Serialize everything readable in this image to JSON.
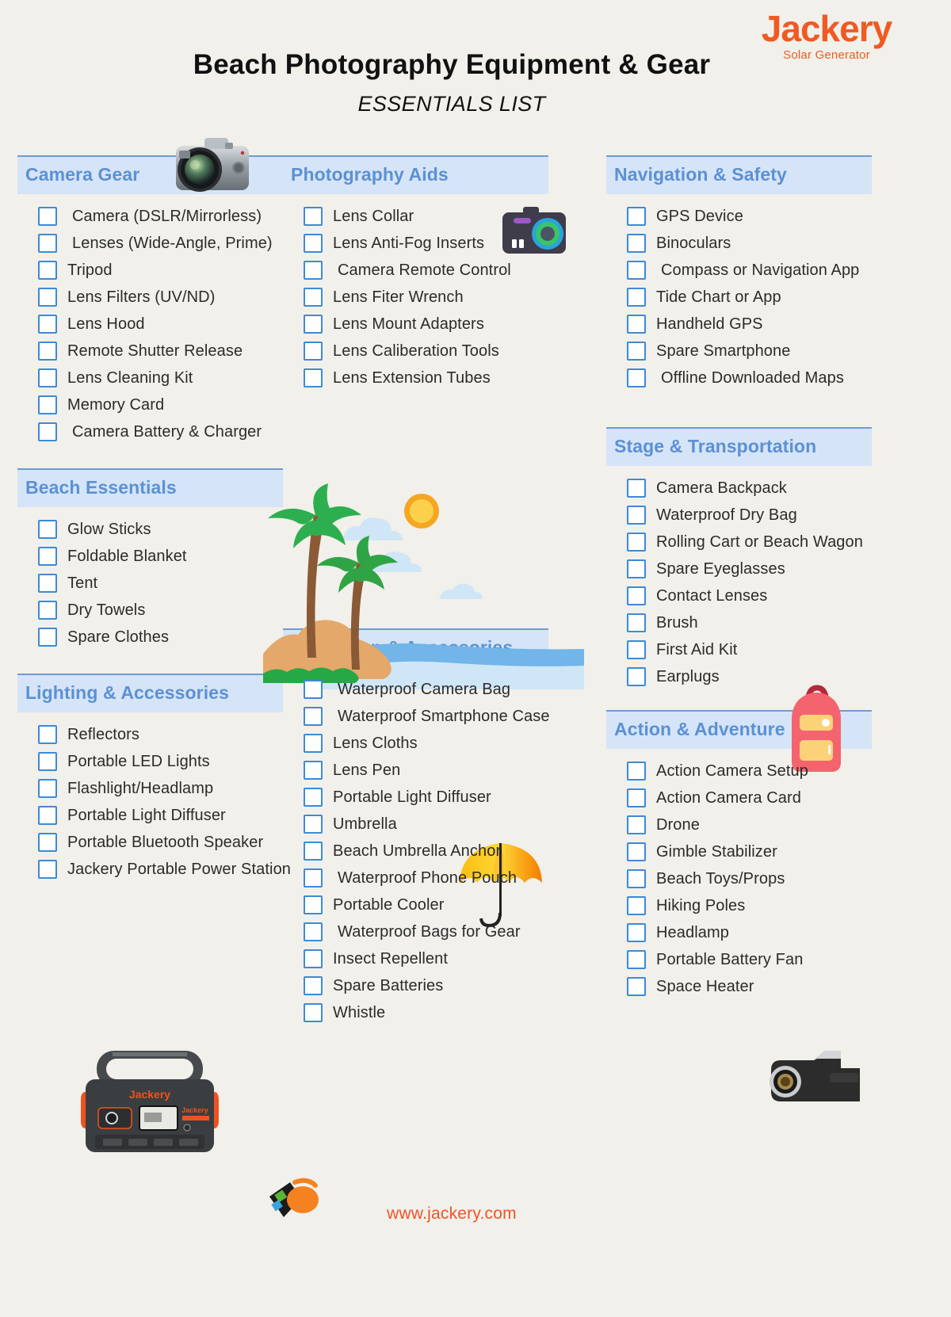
{
  "brand": {
    "name": "Jackery",
    "tagline": "Solar Generator"
  },
  "header": {
    "title": "Beach  Photography Equipment & Gear",
    "subtitle": "ESSENTIALS LIST"
  },
  "footer": {
    "website": "www.jackery.com"
  },
  "colors": {
    "page_background": "#f2f0ea",
    "section_header_bg": "#d5e4f7",
    "section_header_border": "#6f9bd1",
    "section_header_text": "#5b91d4",
    "checkbox_border": "#3d8ad6",
    "brand_orange": "#f05a22",
    "item_text": "#2b2b2b"
  },
  "columns": [
    {
      "sections": [
        {
          "title": "Camera Gear",
          "items": [
            {
              "label": "Camera (DSLR/Mirrorless)",
              "indent": true
            },
            {
              "label": "Lenses (Wide-Angle, Prime)",
              "indent": true
            },
            {
              "label": "Tripod",
              "indent": false
            },
            {
              "label": "Lens Filters (UV/ND)",
              "indent": false
            },
            {
              "label": "Lens Hood",
              "indent": false
            },
            {
              "label": "Remote Shutter Release",
              "indent": false
            },
            {
              "label": "Lens Cleaning Kit",
              "indent": false
            },
            {
              "label": "Memory Card",
              "indent": false
            },
            {
              "label": "Camera Battery & Charger",
              "indent": true
            }
          ]
        },
        {
          "title": "Beach Essentials",
          "items": [
            {
              "label": "Glow Sticks",
              "indent": false
            },
            {
              "label": "Foldable Blanket",
              "indent": false
            },
            {
              "label": "Tent",
              "indent": false
            },
            {
              "label": "Dry Towels",
              "indent": false
            },
            {
              "label": "Spare Clothes",
              "indent": false
            }
          ]
        },
        {
          "title": "Lighting & Accessories",
          "items": [
            {
              "label": "Reflectors",
              "indent": false
            },
            {
              "label": "Portable LED Lights",
              "indent": false
            },
            {
              "label": "Flashlight/Headlamp",
              "indent": false
            },
            {
              "label": "Portable Light Diffuser",
              "indent": false
            },
            {
              "label": "Portable Bluetooth Speaker",
              "indent": false
            },
            {
              "label": "Jackery Portable Power Station",
              "indent": false
            }
          ]
        }
      ]
    },
    {
      "sections": [
        {
          "title": "Photography Aids",
          "items": [
            {
              "label": "Lens Collar",
              "indent": false
            },
            {
              "label": "Lens Anti-Fog Inserts",
              "indent": false
            },
            {
              "label": "Camera Remote Control",
              "indent": true
            },
            {
              "label": "Lens Fiter Wrench",
              "indent": false
            },
            {
              "label": "Lens Mount Adapters",
              "indent": false
            },
            {
              "label": "Lens Caliberation Tools",
              "indent": false
            },
            {
              "label": "Lens Extension Tubes",
              "indent": false
            }
          ]
        },
        {
          "title": "Protection & Accessories",
          "items": [
            {
              "label": "Waterproof Camera Bag",
              "indent": true
            },
            {
              "label": "Waterproof Smartphone Case",
              "indent": true
            },
            {
              "label": "Lens Cloths",
              "indent": false
            },
            {
              "label": "Lens Pen",
              "indent": false
            },
            {
              "label": "Portable Light Diffuser",
              "indent": false
            },
            {
              "label": "Umbrella",
              "indent": false
            },
            {
              "label": "Beach Umbrella Anchor",
              "indent": false
            },
            {
              "label": "Waterproof Phone Pouch",
              "indent": true
            },
            {
              "label": "Portable Cooler",
              "indent": false
            },
            {
              "label": "Waterproof Bags for Gear",
              "indent": true
            },
            {
              "label": "Insect Repellent",
              "indent": false
            },
            {
              "label": "Spare Batteries",
              "indent": false
            },
            {
              "label": "Whistle",
              "indent": false
            }
          ]
        }
      ]
    },
    {
      "sections": [
        {
          "title": "Navigation & Safety",
          "items": [
            {
              "label": "GPS Device",
              "indent": false
            },
            {
              "label": "Binoculars",
              "indent": false
            },
            {
              "label": "Compass or Navigation App",
              "indent": true
            },
            {
              "label": "Tide Chart or App",
              "indent": false
            },
            {
              "label": "Handheld GPS",
              "indent": false
            },
            {
              "label": "Spare Smartphone",
              "indent": false
            },
            {
              "label": "Offline Downloaded Maps",
              "indent": true
            }
          ]
        },
        {
          "title": "Stage & Transportation",
          "items": [
            {
              "label": "Camera Backpack",
              "indent": false
            },
            {
              "label": "Waterproof Dry Bag",
              "indent": false
            },
            {
              "label": "Rolling Cart or Beach Wagon",
              "indent": false
            },
            {
              "label": "Spare Eyeglasses",
              "indent": false
            },
            {
              "label": "Contact Lenses",
              "indent": false
            },
            {
              "label": "Brush",
              "indent": false
            },
            {
              "label": "First Aid Kit",
              "indent": false
            },
            {
              "label": "Earplugs",
              "indent": false
            }
          ]
        },
        {
          "title": "Action & Adventure",
          "items": [
            {
              "label": "Action Camera Setup",
              "indent": false
            },
            {
              "label": "Action Camera Card",
              "indent": false
            },
            {
              "label": "Drone",
              "indent": false
            },
            {
              "label": "Gimble Stabilizer",
              "indent": false
            },
            {
              "label": "Beach Toys/Props",
              "indent": false
            },
            {
              "label": "Hiking Poles",
              "indent": false
            },
            {
              "label": "Headlamp",
              "indent": false
            },
            {
              "label": "Portable Battery Fan",
              "indent": false
            },
            {
              "label": "Space Heater",
              "indent": false
            }
          ]
        }
      ]
    }
  ],
  "decorations": [
    {
      "name": "dslr-camera-image"
    },
    {
      "name": "compact-camera-icon"
    },
    {
      "name": "beach-palm-tree-illustration"
    },
    {
      "name": "umbrella-icon"
    },
    {
      "name": "whistle-icon"
    },
    {
      "name": "backpack-icon"
    },
    {
      "name": "camcorder-image"
    },
    {
      "name": "jackery-power-station-image"
    }
  ]
}
